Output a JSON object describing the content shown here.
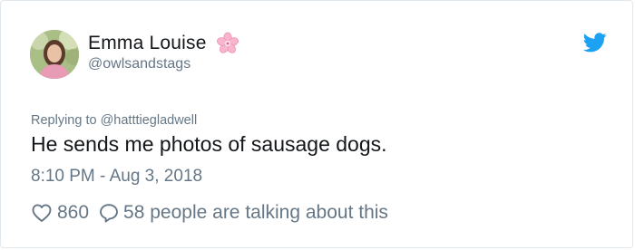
{
  "tweet": {
    "author": {
      "display_name": "Emma Louise",
      "handle": "@owlsandstags",
      "avatar_icon": "profile-photo",
      "name_emoji": "cherry-blossom-icon"
    },
    "reply": {
      "prefix": "Replying to",
      "mention": "@hatttiegladwell"
    },
    "text": "He sends me photos of sausage dogs.",
    "timestamp": "8:10 PM - Aug 3, 2018",
    "likes": "860",
    "talking": "58 people are talking about this"
  },
  "colors": {
    "text_primary": "#14171a",
    "text_secondary": "#657786",
    "twitter_blue": "#1da1f2",
    "border": "#e1e8ed",
    "blossom_pink": "#f7a8c4"
  }
}
